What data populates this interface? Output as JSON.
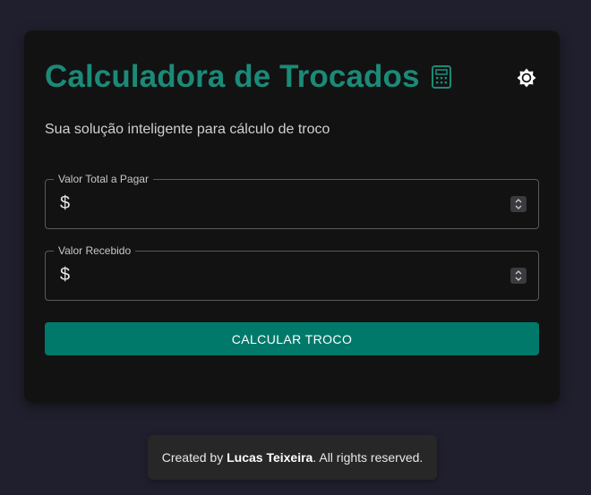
{
  "header": {
    "title": "Calculadora de Trocados",
    "title_icon": "calculator-icon",
    "theme_toggle_icon": "sun-icon",
    "subtitle": "Sua solução inteligente para cálculo de troco"
  },
  "form": {
    "total": {
      "label": "Valor Total a Pagar",
      "prefix": "$",
      "value": ""
    },
    "received": {
      "label": "Valor Recebido",
      "prefix": "$",
      "value": ""
    },
    "submit_label": "CALCULAR TROCO"
  },
  "footer": {
    "prefix": "Created by ",
    "author": "Lucas Teixeira",
    "suffix": ". All rights reserved."
  },
  "colors": {
    "background": "#201f2d",
    "card": "#121212",
    "accent": "#1b8a78",
    "button": "#00796b"
  }
}
